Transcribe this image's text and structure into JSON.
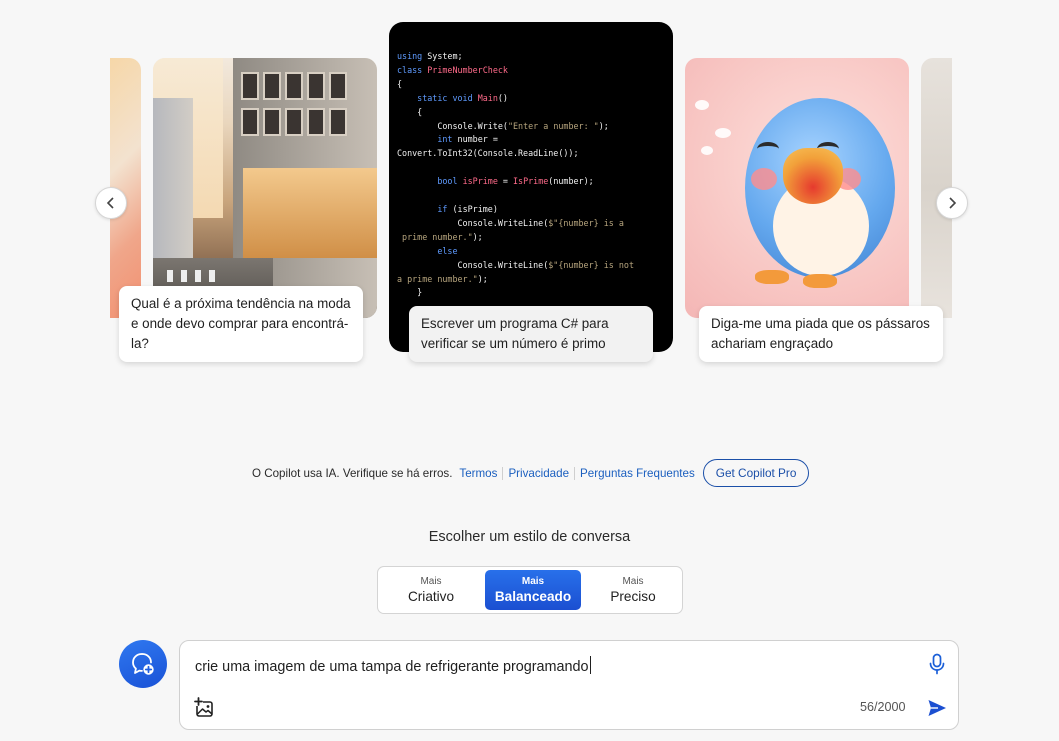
{
  "carousel": {
    "cards": [
      {
        "name": "fashion",
        "caption": "Qual é a próxima tendência na moda e onde devo comprar para encontrá-la?"
      },
      {
        "name": "csharp",
        "caption": "Escrever um programa C# para verificar se um número é primo"
      },
      {
        "name": "bird",
        "caption": "Diga-me uma piada que os pássaros achariam engraçado"
      }
    ],
    "code_lines": [
      "using System;",
      "class PrimeNumberCheck",
      "{",
      "    static void Main()",
      "    {",
      "        Console.Write(\"Enter a number: \");",
      "        int number =",
      "Convert.ToInt32(Console.ReadLine());",
      "",
      "        bool isPrime = IsPrime(number);",
      "",
      "        if (isPrime)",
      "            Console.WriteLine($\"{number} is a",
      " prime number.\");",
      "        else",
      "            Console.WriteLine($\"{number} is not",
      "a prime number.\");",
      "    }"
    ],
    "prev_icon": "chevron-left-icon",
    "next_icon": "chevron-right-icon"
  },
  "footer": {
    "disclaimer": "O Copilot usa IA. Verifique se há erros.",
    "terms": "Termos",
    "privacy": "Privacidade",
    "faq": "Perguntas Frequentes",
    "pro": "Get Copilot Pro"
  },
  "style_selector": {
    "title": "Escolher um estilo de conversa",
    "options": [
      {
        "small": "Mais",
        "label": "Criativo",
        "selected": false
      },
      {
        "small": "Mais",
        "label": "Balanceado",
        "selected": true
      },
      {
        "small": "Mais",
        "label": "Preciso",
        "selected": false
      }
    ]
  },
  "composer": {
    "text": "crie uma imagem de uma tampa de refrigerante programando",
    "counter": "56/2000",
    "icons": [
      "new-topic-icon",
      "microphone-icon",
      "add-image-icon",
      "send-icon"
    ]
  },
  "colors": {
    "accent": "#1b4fd1",
    "link": "#1b5fbf",
    "background": "#f7f7f7"
  }
}
